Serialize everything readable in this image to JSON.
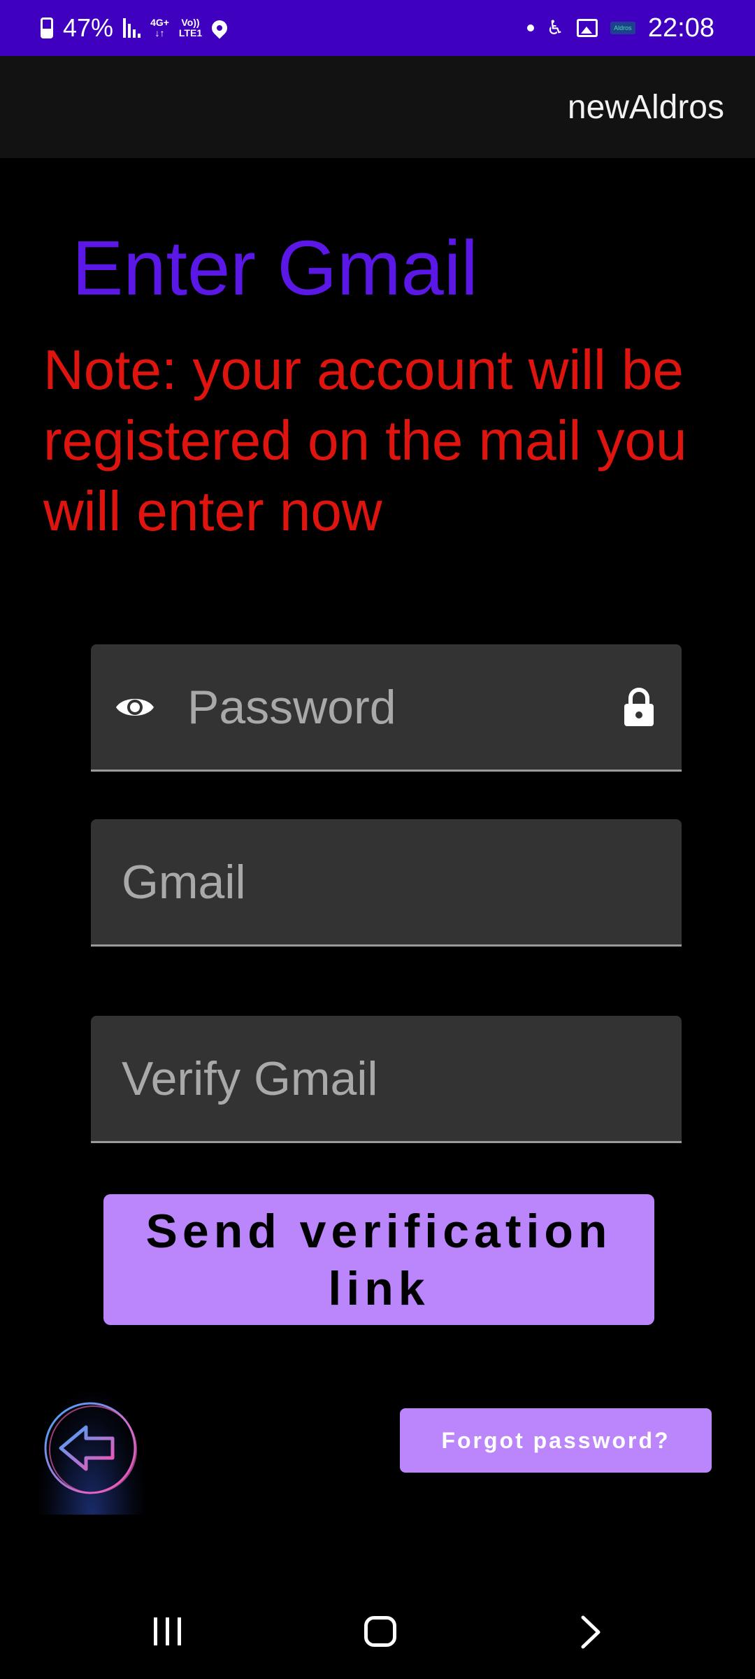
{
  "status_bar": {
    "battery": "47%",
    "network_top": "4G+",
    "network_bottom": "",
    "volte_top": "Vo))",
    "volte_bottom": "LTE1",
    "mini_app": "Aldros",
    "time": "22:08"
  },
  "app_bar": {
    "title": "newAldros"
  },
  "main": {
    "heading": "Enter Gmail",
    "note": "Note: your account will be registered on the mail you will enter now",
    "password_placeholder": "Password",
    "gmail_placeholder": "Gmail",
    "verify_gmail_placeholder": "Verify Gmail",
    "send_button_label": "Send verification link",
    "forgot_button_label": "Forgot password?"
  },
  "icons": {
    "password_toggle": "eye-icon",
    "password_lock": "lock-icon",
    "back": "arrow-left-icon"
  },
  "colors": {
    "status_bar": "#3f01bf",
    "heading": "#5a17e6",
    "note": "#e0140f",
    "button": "#bb86fc",
    "field": "#333333"
  }
}
